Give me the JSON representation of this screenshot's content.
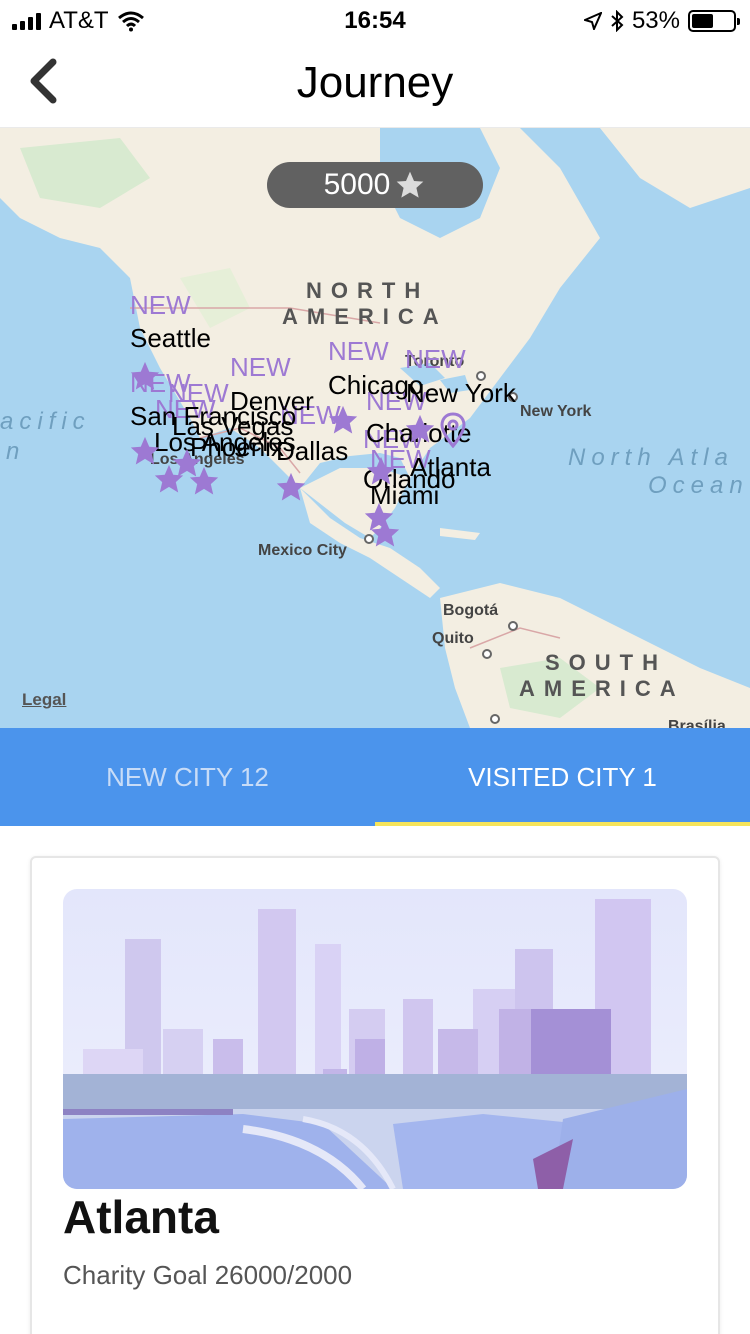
{
  "status_bar": {
    "carrier": "AT&T",
    "time": "16:54",
    "battery": "53%",
    "battery_level": 0.53
  },
  "nav": {
    "title": "Journey",
    "back_icon": "chevron-left-icon"
  },
  "map": {
    "score": "5000",
    "score_icon": "star-icon",
    "legal": "Legal",
    "regions": {
      "north_america_1": "NORTH",
      "north_america_2": "AMERICA",
      "south_america_1": "SOUTH",
      "south_america_2": "AMERICA",
      "ocean_left_1": "acific",
      "ocean_left_2": "n",
      "ocean_right_1": "North Atla",
      "ocean_right_2": "Ocean"
    },
    "places": {
      "toronto": "Toronto",
      "new_york_base": "New York",
      "los_angeles_base": "Los Angeles",
      "mexico_city": "Mexico City",
      "bogota": "Bogotá",
      "quito": "Quito",
      "brasilia": "Brasília"
    },
    "new_tag": "NEW",
    "cities": {
      "seattle": "Seattle",
      "san_francisco": "San Francisco",
      "las_vegas": "Las Vegas",
      "los_angeles": "Los Angeles",
      "phoenix": "Phoenix",
      "denver": "Denver",
      "dallas": "Dallas",
      "chicago": "Chicago",
      "new_york": "New York",
      "charlotte": "Charlotte",
      "atlanta": "Atlanta",
      "orlando": "Orlando",
      "miami": "Miami"
    },
    "colors": {
      "water": "#a9d4f0",
      "land": "#f3eee2",
      "marker": "#9d79d3"
    }
  },
  "tabs": {
    "new_city": "NEW CITY 12",
    "visited_city": "VISITED CITY 1"
  },
  "card": {
    "title": "Atlanta",
    "subtitle": "Charity Goal 26000/2000"
  },
  "colors": {
    "tab_bar": "#4b94ec",
    "tab_indicator": "#f6e45a",
    "pill": "#616161"
  }
}
